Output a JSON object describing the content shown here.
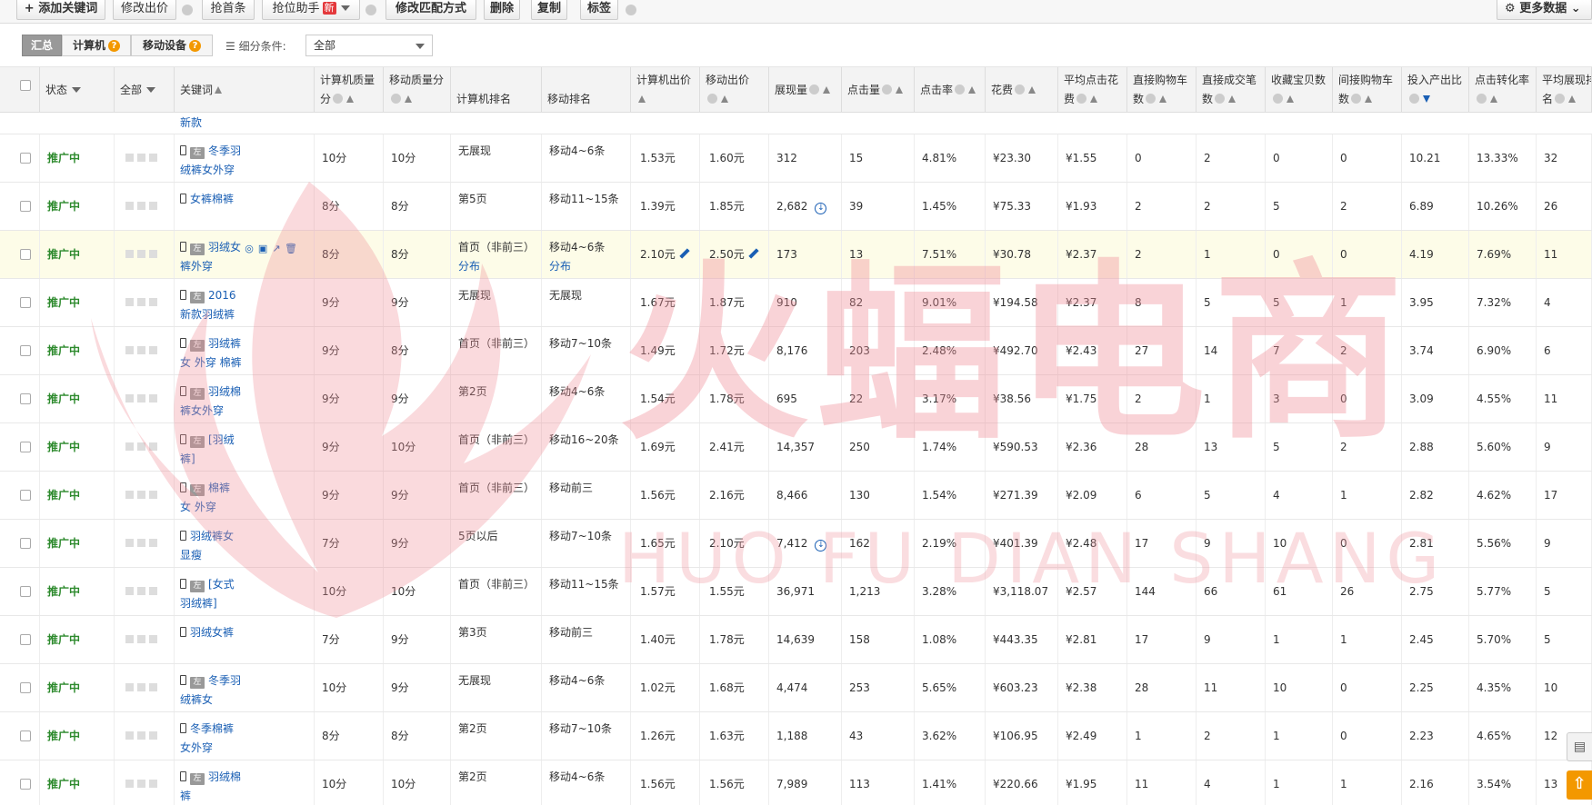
{
  "toolbar": {
    "add_keyword": "+ 添加关键词",
    "modify_bid": "修改出价",
    "grab_first": "抢首条",
    "rank_helper": "抢位助手",
    "new_badge": "新",
    "modify_match": "修改匹配方式",
    "delete": "删除",
    "copy": "复制",
    "tag": "标签",
    "more_data": "更多数据"
  },
  "filter": {
    "tab_summary": "汇总",
    "tab_computer": "计算机",
    "tab_mobile": "移动设备",
    "sub_condition_label": "细分条件:",
    "sub_condition_value": "全部",
    "help_glyph": "?"
  },
  "columns": {
    "status": "状态",
    "all": "全部",
    "keyword": "关键词",
    "pc_quality_1": "计算机质量",
    "pc_quality_2": "分",
    "mobile_quality_1": "移动质量分",
    "pc_rank": "计算机排名",
    "mobile_rank": "移动排名",
    "pc_bid": "计算机出价",
    "mobile_bid": "移动出价",
    "impressions": "展现量",
    "clicks": "点击量",
    "ctr": "点击率",
    "cost": "花费",
    "avg_cpc_1": "平均点击花",
    "avg_cpc_2": "费",
    "direct_cart_1": "直接购物车",
    "direct_cart_2": "数",
    "direct_deal_1": "直接成交笔",
    "direct_deal_2": "数",
    "fav_items": "收藏宝贝数",
    "indirect_cart_1": "间接购物车",
    "indirect_cart_2": "数",
    "roi": "投入产出比",
    "cvr": "点击转化率",
    "avg_rank_1": "平均展现排",
    "avg_rank_2": "名"
  },
  "partial_row": {
    "keyword": "新款"
  },
  "rows": [
    {
      "status": "推广中",
      "kw1": "冬季羽",
      "kw2": "绒裤女外穿",
      "ad": true,
      "pcq": "10分",
      "mq": "10分",
      "pcr1": "无展现",
      "pcr2": "",
      "mr1": "移动4~6条",
      "mr2": "",
      "pcb": "1.53元",
      "mb": "1.60元",
      "imp": "312",
      "clk": "15",
      "ctr": "4.81%",
      "cost": "¥23.30",
      "cpc": "¥1.55",
      "dc": "0",
      "dd": "2",
      "fav": "0",
      "ic": "0",
      "roi": "10.21",
      "cvr": "13.33%",
      "rank": "32",
      "dl": false,
      "hl": false
    },
    {
      "status": "推广中",
      "kw1": "女裤棉裤",
      "kw2": "",
      "ad": false,
      "pcq": "8分",
      "mq": "8分",
      "pcr1": "第5页",
      "pcr2": "",
      "mr1": "移动11~15条",
      "mr2": "",
      "pcb": "1.39元",
      "mb": "1.85元",
      "imp": "2,682",
      "clk": "39",
      "ctr": "1.45%",
      "cost": "¥75.33",
      "cpc": "¥1.93",
      "dc": "2",
      "dd": "2",
      "fav": "5",
      "ic": "2",
      "roi": "6.89",
      "cvr": "10.26%",
      "rank": "26",
      "dl": true,
      "hl": false
    },
    {
      "status": "推广中",
      "kw1": "羽绒女",
      "kw2": "裤外穿",
      "ad": true,
      "pcq": "8分",
      "mq": "8分",
      "pcr1": "首页（非前三）",
      "pcr2": "分布",
      "mr1": "移动4~6条",
      "mr2": "分布",
      "pcb": "2.10元",
      "mb": "2.50元",
      "imp": "173",
      "clk": "13",
      "ctr": "7.51%",
      "cost": "¥30.78",
      "cpc": "¥2.37",
      "dc": "2",
      "dd": "1",
      "fav": "0",
      "ic": "0",
      "roi": "4.19",
      "cvr": "7.69%",
      "rank": "11",
      "dl": false,
      "hl": true
    },
    {
      "status": "推广中",
      "kw1": "2016",
      "kw2": "新款羽绒裤",
      "ad": true,
      "pcq": "9分",
      "mq": "9分",
      "pcr1": "无展现",
      "pcr2": "",
      "mr1": "无展现",
      "mr2": "",
      "pcb": "1.67元",
      "mb": "1.87元",
      "imp": "910",
      "clk": "82",
      "ctr": "9.01%",
      "cost": "¥194.58",
      "cpc": "¥2.37",
      "dc": "8",
      "dd": "5",
      "fav": "5",
      "ic": "1",
      "roi": "3.95",
      "cvr": "7.32%",
      "rank": "4",
      "dl": false,
      "hl": false
    },
    {
      "status": "推广中",
      "kw1": "羽绒裤",
      "kw2": "女 外穿 棉裤",
      "ad": true,
      "pcq": "9分",
      "mq": "8分",
      "pcr1": "首页（非前三）",
      "pcr2": "",
      "mr1": "移动7~10条",
      "mr2": "",
      "pcb": "1.49元",
      "mb": "1.72元",
      "imp": "8,176",
      "clk": "203",
      "ctr": "2.48%",
      "cost": "¥492.70",
      "cpc": "¥2.43",
      "dc": "27",
      "dd": "14",
      "fav": "7",
      "ic": "2",
      "roi": "3.74",
      "cvr": "6.90%",
      "rank": "6",
      "dl": false,
      "hl": false
    },
    {
      "status": "推广中",
      "kw1": "羽绒棉",
      "kw2": "裤女外穿",
      "ad": true,
      "pcq": "9分",
      "mq": "9分",
      "pcr1": "第2页",
      "pcr2": "",
      "mr1": "移动4~6条",
      "mr2": "",
      "pcb": "1.54元",
      "mb": "1.78元",
      "imp": "695",
      "clk": "22",
      "ctr": "3.17%",
      "cost": "¥38.56",
      "cpc": "¥1.75",
      "dc": "2",
      "dd": "1",
      "fav": "3",
      "ic": "0",
      "roi": "3.09",
      "cvr": "4.55%",
      "rank": "11",
      "dl": false,
      "hl": false
    },
    {
      "status": "推广中",
      "kw1": "[羽绒",
      "kw2": "裤]",
      "ad": true,
      "pcq": "9分",
      "mq": "10分",
      "pcr1": "首页（非前三）",
      "pcr2": "",
      "mr1": "移动16~20条",
      "mr2": "",
      "pcb": "1.69元",
      "mb": "2.41元",
      "imp": "14,357",
      "clk": "250",
      "ctr": "1.74%",
      "cost": "¥590.53",
      "cpc": "¥2.36",
      "dc": "28",
      "dd": "13",
      "fav": "5",
      "ic": "2",
      "roi": "2.88",
      "cvr": "5.60%",
      "rank": "9",
      "dl": false,
      "hl": false
    },
    {
      "status": "推广中",
      "kw1": "棉裤",
      "kw2": "女 外穿",
      "ad": true,
      "pcq": "9分",
      "mq": "9分",
      "pcr1": "首页（非前三）",
      "pcr2": "",
      "mr1": "移动前三",
      "mr2": "",
      "pcb": "1.56元",
      "mb": "2.16元",
      "imp": "8,466",
      "clk": "130",
      "ctr": "1.54%",
      "cost": "¥271.39",
      "cpc": "¥2.09",
      "dc": "6",
      "dd": "5",
      "fav": "4",
      "ic": "1",
      "roi": "2.82",
      "cvr": "4.62%",
      "rank": "17",
      "dl": false,
      "hl": false
    },
    {
      "status": "推广中",
      "kw1": "羽绒裤女",
      "kw2": "显瘦",
      "ad": false,
      "pcq": "7分",
      "mq": "9分",
      "pcr1": "5页以后",
      "pcr2": "",
      "mr1": "移动7~10条",
      "mr2": "",
      "pcb": "1.65元",
      "mb": "2.10元",
      "imp": "7,412",
      "clk": "162",
      "ctr": "2.19%",
      "cost": "¥401.39",
      "cpc": "¥2.48",
      "dc": "17",
      "dd": "9",
      "fav": "10",
      "ic": "0",
      "roi": "2.81",
      "cvr": "5.56%",
      "rank": "9",
      "dl": true,
      "hl": false
    },
    {
      "status": "推广中",
      "kw1": "[女式",
      "kw2": "羽绒裤]",
      "ad": true,
      "pcq": "10分",
      "mq": "10分",
      "pcr1": "首页（非前三）",
      "pcr2": "",
      "mr1": "移动11~15条",
      "mr2": "",
      "pcb": "1.57元",
      "mb": "1.55元",
      "imp": "36,971",
      "clk": "1,213",
      "ctr": "3.28%",
      "cost": "¥3,118.07",
      "cpc": "¥2.57",
      "dc": "144",
      "dd": "66",
      "fav": "61",
      "ic": "26",
      "roi": "2.75",
      "cvr": "5.77%",
      "rank": "5",
      "dl": false,
      "hl": false
    },
    {
      "status": "推广中",
      "kw1": "羽绒女裤",
      "kw2": "",
      "ad": false,
      "pcq": "7分",
      "mq": "9分",
      "pcr1": "第3页",
      "pcr2": "",
      "mr1": "移动前三",
      "mr2": "",
      "pcb": "1.40元",
      "mb": "1.78元",
      "imp": "14,639",
      "clk": "158",
      "ctr": "1.08%",
      "cost": "¥443.35",
      "cpc": "¥2.81",
      "dc": "17",
      "dd": "9",
      "fav": "1",
      "ic": "1",
      "roi": "2.45",
      "cvr": "5.70%",
      "rank": "5",
      "dl": false,
      "hl": false
    },
    {
      "status": "推广中",
      "kw1": "冬季羽",
      "kw2": "绒裤女",
      "ad": true,
      "pcq": "10分",
      "mq": "9分",
      "pcr1": "无展现",
      "pcr2": "",
      "mr1": "移动4~6条",
      "mr2": "",
      "pcb": "1.02元",
      "mb": "1.68元",
      "imp": "4,474",
      "clk": "253",
      "ctr": "5.65%",
      "cost": "¥603.23",
      "cpc": "¥2.38",
      "dc": "28",
      "dd": "11",
      "fav": "10",
      "ic": "0",
      "roi": "2.25",
      "cvr": "4.35%",
      "rank": "10",
      "dl": false,
      "hl": false
    },
    {
      "status": "推广中",
      "kw1": "冬季棉裤",
      "kw2": "女外穿",
      "ad": false,
      "pcq": "8分",
      "mq": "8分",
      "pcr1": "第2页",
      "pcr2": "",
      "mr1": "移动7~10条",
      "mr2": "",
      "pcb": "1.26元",
      "mb": "1.63元",
      "imp": "1,188",
      "clk": "43",
      "ctr": "3.62%",
      "cost": "¥106.95",
      "cpc": "¥2.49",
      "dc": "1",
      "dd": "2",
      "fav": "1",
      "ic": "0",
      "roi": "2.23",
      "cvr": "4.65%",
      "rank": "12",
      "dl": false,
      "hl": false
    },
    {
      "status": "推广中",
      "kw1": "羽绒棉",
      "kw2": "裤",
      "ad": true,
      "pcq": "10分",
      "mq": "10分",
      "pcr1": "第2页",
      "pcr2": "",
      "mr1": "移动4~6条",
      "mr2": "",
      "pcb": "1.56元",
      "mb": "1.56元",
      "imp": "7,989",
      "clk": "113",
      "ctr": "1.41%",
      "cost": "¥220.66",
      "cpc": "¥1.95",
      "dc": "11",
      "dd": "4",
      "fav": "1",
      "ic": "1",
      "roi": "2.16",
      "cvr": "3.54%",
      "rank": "13",
      "dl": false,
      "hl": false
    }
  ],
  "watermark": {
    "main": "火蝠电商",
    "sub": "HUO FU DIAN SHANG"
  },
  "colors": {
    "status_green": "#2d8a2d",
    "link_blue": "#1a5fb4",
    "badge_red": "#e4393c",
    "help_orange": "#f39800",
    "highlight_row": "#fdfce8",
    "watermark_pink": "#f08c96"
  },
  "icons": {
    "mobile": "mobile-phone-icon",
    "ad": "ad-badge-icon",
    "download": "download-circle-icon",
    "edit": "pencil-icon",
    "gear": "gear-icon",
    "scroll_top": "arrow-up-icon"
  },
  "ad_label": "左",
  "dl_glyph": "↓",
  "tool_glyphs": [
    "◎",
    "▣",
    "↗",
    "🗑"
  ],
  "gear_glyph": "⚙",
  "chevron_glyph": "⌄",
  "list_glyph": "☰",
  "up_glyph": "⇧",
  "printer_glyph": "▤"
}
